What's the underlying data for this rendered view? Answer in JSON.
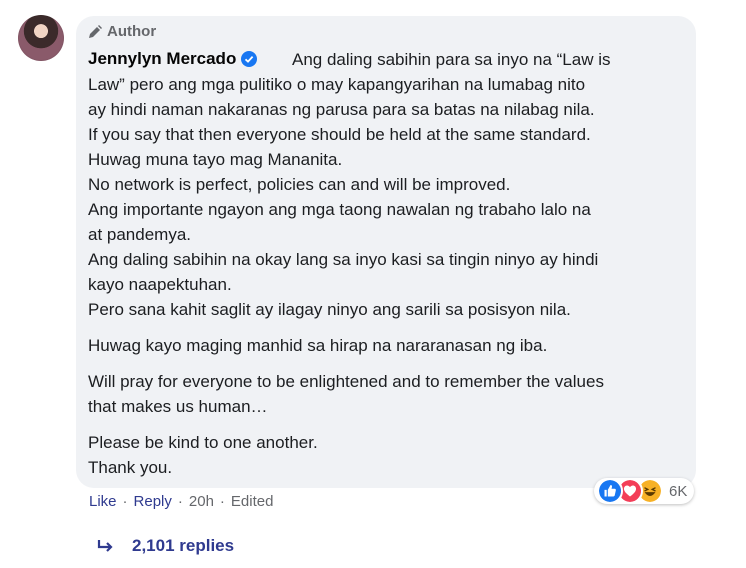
{
  "comment": {
    "badge_label": "Author",
    "author_name": "Jennylyn Mercado",
    "lines": [
      "Ang daling sabihin para sa inyo na “Law is",
      "Law” pero ang mga pulitiko o may kapangyarihan na lumabag nito",
      "ay hindi naman nakaranas ng parusa para sa batas na nilabag nila.",
      "If you say that then everyone should be held at the same standard.",
      "Huwag muna tayo mag Mananita.",
      "No network is perfect, policies can and will be improved.",
      "Ang importante ngayon ang mga taong nawalan ng trabaho lalo na",
      "at pandemya.",
      "Ang daling sabihin na okay lang sa inyo kasi sa tingin ninyo ay hindi",
      "kayo naapektuhan.",
      "Pero sana kahit saglit ay ilagay ninyo ang sarili sa posisyon nila.",
      "Huwag kayo maging manhid sa hirap na nararanasan ng iba.",
      "Will pray for everyone to be enlightened and to remember the values",
      "that makes us human…",
      "Please be kind to one another.",
      "Thank you."
    ]
  },
  "actions": {
    "like": "Like",
    "reply": "Reply",
    "time": "20h",
    "edited": "Edited",
    "separator": "·"
  },
  "reactions": {
    "icons": [
      "like-icon",
      "love-icon",
      "haha-icon"
    ],
    "count": "6K",
    "colors": {
      "like": "#1877f2",
      "love": "#f33e58",
      "haha": "#f7b125"
    }
  },
  "replies": {
    "label": "2,101 replies"
  },
  "colors": {
    "bubble": "#f0f2f5",
    "link": "#2f3a8f",
    "muted": "#65676b"
  }
}
